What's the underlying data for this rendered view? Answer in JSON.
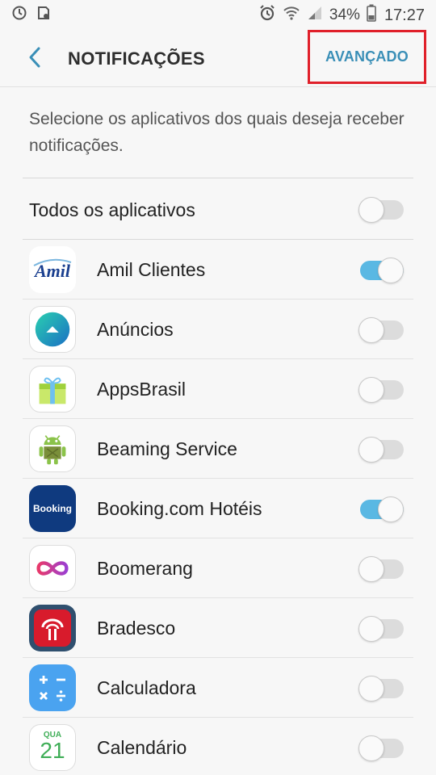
{
  "status_bar": {
    "battery_percent": "34%",
    "time": "17:27",
    "icons": [
      "sync-icon",
      "sd-card-icon",
      "alarm-icon",
      "wifi-icon",
      "signal-icon",
      "battery-icon"
    ]
  },
  "header": {
    "title": "NOTIFICAÇÕES",
    "advanced_label": "AVANÇADO"
  },
  "description": "Selecione os aplicativos dos quais deseja receber notificações.",
  "all_apps": {
    "label": "Todos os aplicativos",
    "enabled": false
  },
  "apps": [
    {
      "name": "Amil Clientes",
      "icon": "amil-icon",
      "enabled": true
    },
    {
      "name": "Anúncios",
      "icon": "anuncios-icon",
      "enabled": false
    },
    {
      "name": "AppsBrasil",
      "icon": "appsbrasil-icon",
      "enabled": false
    },
    {
      "name": "Beaming Service",
      "icon": "android-robot-icon",
      "enabled": false
    },
    {
      "name": "Booking.com Hotéis",
      "icon": "booking-icon",
      "icon_text": "Booking",
      "enabled": true
    },
    {
      "name": "Boomerang",
      "icon": "infinity-icon",
      "enabled": false
    },
    {
      "name": "Bradesco",
      "icon": "bradesco-icon",
      "enabled": false
    },
    {
      "name": "Calculadora",
      "icon": "calculator-icon",
      "enabled": false
    },
    {
      "name": "Calendário",
      "icon": "calendar-icon",
      "icon_day": "QUA",
      "icon_date": "21",
      "enabled": false
    }
  ],
  "colors": {
    "accent": "#5ab8e3",
    "link": "#3a8fb7",
    "highlight_border": "#e0202a"
  }
}
